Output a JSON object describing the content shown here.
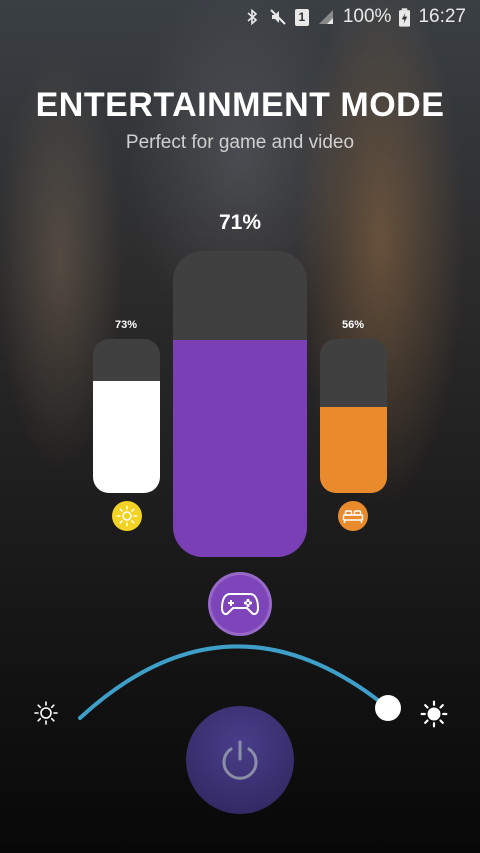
{
  "status_bar": {
    "battery": "100%",
    "time": "16:27",
    "sim_slot": "1",
    "icons": [
      "bluetooth-icon",
      "mute-icon",
      "sim-icon",
      "signal-icon",
      "battery-charging-icon"
    ]
  },
  "header": {
    "title": "ENTERTAINMENT MODE",
    "subtitle": "Perfect for game and video"
  },
  "sliders": {
    "main": {
      "label": "71%",
      "level": 0.71,
      "color": "#7b3fb5",
      "icon": "gamepad-icon"
    },
    "left": {
      "label": "73%",
      "level": 0.73,
      "color": "#ffffff",
      "icon": "sun-icon",
      "icon_color": "#f2d324"
    },
    "right": {
      "label": "56%",
      "level": 0.56,
      "color": "#e98b2d",
      "icon": "bed-icon",
      "icon_color": "#e98b2d"
    }
  },
  "brightness": {
    "level": 1.0,
    "arc_color": "#3ea0c9",
    "min_icon": "brightness-low-icon",
    "max_icon": "brightness-high-icon"
  },
  "power": {
    "icon": "power-icon"
  }
}
